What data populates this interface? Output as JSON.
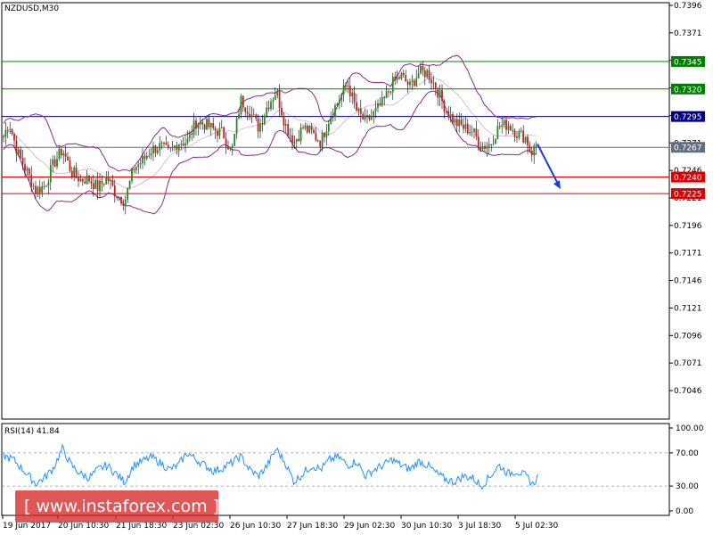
{
  "chart_data": [
    {
      "type": "candlestick",
      "title": "NZDUSD,M30",
      "ylim": [
        0.7046,
        0.7396
      ],
      "y_ticks": [
        "0.7396",
        "0.7371",
        "0.7346",
        "0.7321",
        "0.7296",
        "0.7271",
        "0.7246",
        "0.7221",
        "0.7196",
        "0.7171",
        "0.7146",
        "0.7121",
        "0.7096",
        "0.7071",
        "0.7046"
      ],
      "x_ticks": [
        "19 Jun 2017",
        "20 Jun 10:30",
        "21 Jun 18:30",
        "23 Jun 02:30",
        "26 Jun 10:30",
        "27 Jun 18:30",
        "29 Jun 02:30",
        "30 Jun 10:30",
        "3 Jul 18:30",
        "5 Jul 02:30"
      ],
      "levels": [
        {
          "value": 0.7345,
          "label": "0.7345",
          "color": "#008000"
        },
        {
          "value": 0.732,
          "label": "0.7320",
          "color": "#008000"
        },
        {
          "value": 0.7295,
          "label": "0.7295",
          "color": "#000080"
        },
        {
          "value": 0.7267,
          "label": "0.7267",
          "color": "#607080"
        },
        {
          "value": 0.724,
          "label": "0.7240",
          "color": "#e00000"
        },
        {
          "value": 0.7225,
          "label": "0.7225",
          "color": "#e00000"
        }
      ],
      "series_points": [
        [
          0,
          0.7268
        ],
        [
          10,
          0.729
        ],
        [
          20,
          0.7262
        ],
        [
          30,
          0.7245
        ],
        [
          40,
          0.7228
        ],
        [
          50,
          0.7232
        ],
        [
          60,
          0.7252
        ],
        [
          70,
          0.7265
        ],
        [
          80,
          0.7245
        ],
        [
          90,
          0.7238
        ],
        [
          100,
          0.7238
        ],
        [
          110,
          0.723
        ],
        [
          120,
          0.724
        ],
        [
          130,
          0.7225
        ],
        [
          140,
          0.7218
        ],
        [
          150,
          0.7248
        ],
        [
          160,
          0.7255
        ],
        [
          170,
          0.7265
        ],
        [
          180,
          0.7268
        ],
        [
          190,
          0.7262
        ],
        [
          200,
          0.7272
        ],
        [
          210,
          0.7272
        ],
        [
          220,
          0.729
        ],
        [
          230,
          0.7288
        ],
        [
          240,
          0.7283
        ],
        [
          250,
          0.728
        ],
        [
          260,
          0.7262
        ],
        [
          270,
          0.731
        ],
        [
          280,
          0.73
        ],
        [
          290,
          0.7285
        ],
        [
          300,
          0.7305
        ],
        [
          310,
          0.7318
        ],
        [
          320,
          0.7288
        ],
        [
          330,
          0.7272
        ],
        [
          340,
          0.7285
        ],
        [
          350,
          0.728
        ],
        [
          360,
          0.7272
        ],
        [
          370,
          0.7295
        ],
        [
          380,
          0.731
        ],
        [
          390,
          0.7325
        ],
        [
          400,
          0.73
        ],
        [
          410,
          0.729
        ],
        [
          420,
          0.7298
        ],
        [
          430,
          0.7308
        ],
        [
          440,
          0.7325
        ],
        [
          450,
          0.7332
        ],
        [
          460,
          0.7322
        ],
        [
          470,
          0.7335
        ],
        [
          480,
          0.7335
        ],
        [
          490,
          0.732
        ],
        [
          500,
          0.7302
        ],
        [
          510,
          0.729
        ],
        [
          520,
          0.7285
        ],
        [
          530,
          0.7282
        ],
        [
          540,
          0.7268
        ],
        [
          550,
          0.727
        ],
        [
          560,
          0.7286
        ],
        [
          570,
          0.7288
        ],
        [
          580,
          0.728
        ],
        [
          590,
          0.7276
        ],
        [
          596,
          0.7262
        ],
        [
          603,
          0.727
        ]
      ],
      "forecast_arrow": {
        "from": [
          603,
          0.727
        ],
        "to": [
          629,
          0.7229
        ],
        "color": "#1a3fd8"
      }
    },
    {
      "type": "line",
      "title": "RSI(14) 41.84",
      "ylim": [
        0,
        100
      ],
      "y_ticks": [
        "100.00",
        "70.00",
        "30.00",
        "0.00"
      ],
      "levels": [
        70,
        30
      ],
      "series_points": [
        [
          0,
          68
        ],
        [
          15,
          62
        ],
        [
          30,
          45
        ],
        [
          40,
          33
        ],
        [
          50,
          40
        ],
        [
          60,
          52
        ],
        [
          70,
          75
        ],
        [
          80,
          55
        ],
        [
          90,
          45
        ],
        [
          100,
          40
        ],
        [
          110,
          50
        ],
        [
          120,
          55
        ],
        [
          130,
          45
        ],
        [
          140,
          35
        ],
        [
          150,
          55
        ],
        [
          160,
          60
        ],
        [
          170,
          65
        ],
        [
          180,
          58
        ],
        [
          190,
          50
        ],
        [
          200,
          55
        ],
        [
          210,
          70
        ],
        [
          220,
          62
        ],
        [
          230,
          55
        ],
        [
          240,
          48
        ],
        [
          250,
          52
        ],
        [
          260,
          58
        ],
        [
          270,
          66
        ],
        [
          280,
          50
        ],
        [
          290,
          42
        ],
        [
          300,
          55
        ],
        [
          310,
          75
        ],
        [
          320,
          58
        ],
        [
          330,
          35
        ],
        [
          340,
          45
        ],
        [
          350,
          55
        ],
        [
          360,
          50
        ],
        [
          370,
          62
        ],
        [
          380,
          65
        ],
        [
          390,
          55
        ],
        [
          400,
          60
        ],
        [
          410,
          42
        ],
        [
          420,
          50
        ],
        [
          430,
          55
        ],
        [
          440,
          62
        ],
        [
          450,
          55
        ],
        [
          460,
          50
        ],
        [
          470,
          60
        ],
        [
          480,
          55
        ],
        [
          490,
          45
        ],
        [
          500,
          38
        ],
        [
          510,
          35
        ],
        [
          520,
          42
        ],
        [
          530,
          40
        ],
        [
          540,
          30
        ],
        [
          550,
          42
        ],
        [
          560,
          55
        ],
        [
          570,
          45
        ],
        [
          580,
          48
        ],
        [
          590,
          42
        ],
        [
          598,
          32
        ],
        [
          604,
          42
        ]
      ]
    }
  ],
  "watermark": "[ www.instaforex.com ]"
}
